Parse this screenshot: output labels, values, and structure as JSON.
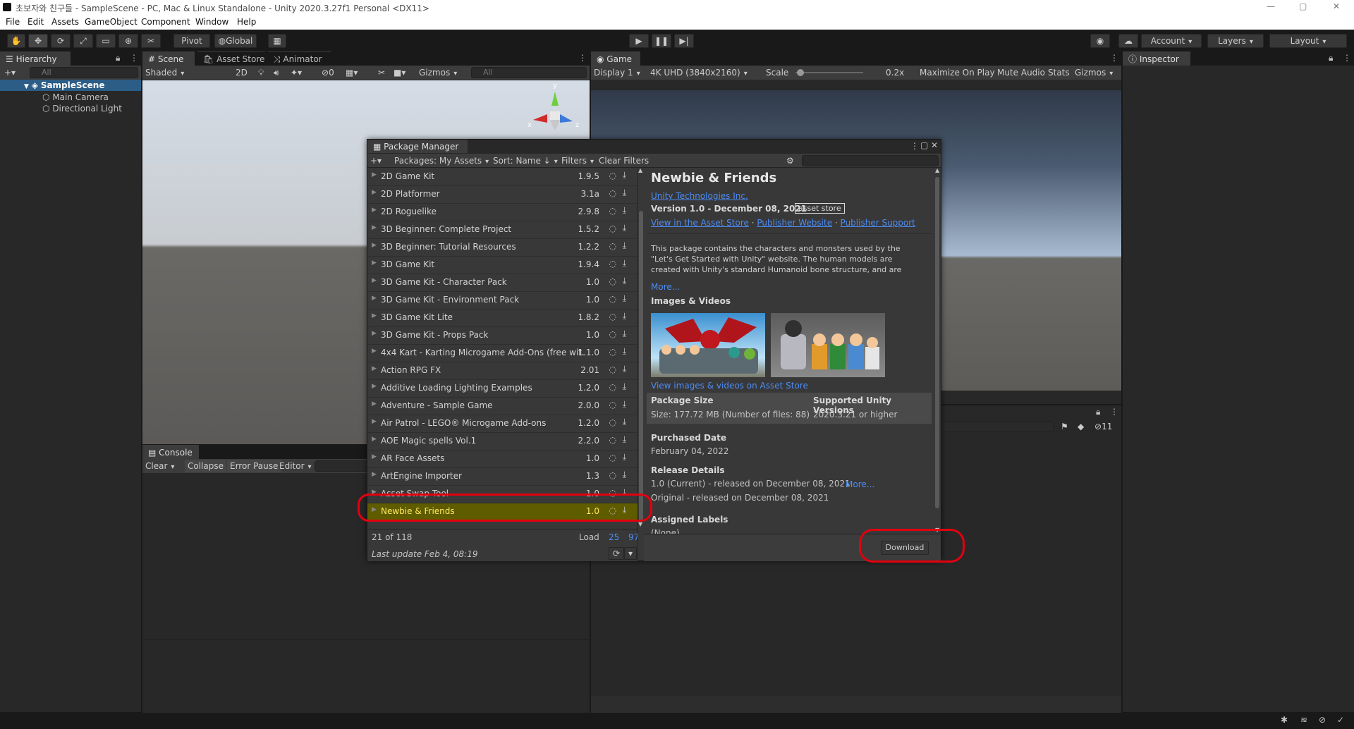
{
  "window": {
    "title": "초보자와 친구들 - SampleScene - PC, Mac & Linux Standalone - Unity 2020.3.27f1 Personal <DX11>",
    "controls": [
      "—",
      "▢",
      "✕"
    ]
  },
  "menu": [
    "File",
    "Edit",
    "Assets",
    "GameObject",
    "Component",
    "Window",
    "Help"
  ],
  "toolbar": {
    "pivot": "Pivot",
    "global": "Global",
    "account": "Account",
    "layers": "Layers",
    "layout": "Layout"
  },
  "hierarchy": {
    "tab": "Hierarchy",
    "search_placeholder": "All",
    "scene": "SampleScene",
    "items": [
      "Main Camera",
      "Directional Light"
    ]
  },
  "scene": {
    "tabs": [
      "Scene",
      "Asset Store",
      "Animator"
    ],
    "shading": "Shaded",
    "mode_2d": "2D",
    "audio_count": "0",
    "gizmos": "Gizmos",
    "search_placeholder": "All",
    "axis_x": "x",
    "axis_y": "y",
    "axis_z": "z"
  },
  "game": {
    "tab": "Game",
    "display": "Display 1",
    "resolution": "4K UHD (3840x2160)",
    "scale_label": "Scale",
    "scale_value": "0.2x",
    "scale_level": 0.02,
    "maximize": "Maximize On Play",
    "mute": "Mute Audio",
    "stats": "Stats",
    "gizmos": "Gizmos"
  },
  "inspector": {
    "tab": "Inspector"
  },
  "console": {
    "tab": "Console",
    "clear": "Clear",
    "collapse": "Collapse",
    "error_pause": "Error Pause",
    "editor": "Editor"
  },
  "project_panel": {
    "count": "11"
  },
  "package_manager": {
    "title": "Package Manager",
    "packages_filter": "Packages: My Assets",
    "sort": "Sort: Name ↓",
    "filters": "Filters",
    "clear_filters": "Clear Filters",
    "list": [
      {
        "name": "2D Game Kit",
        "version": "1.9.5"
      },
      {
        "name": "2D Platformer",
        "version": "3.1a"
      },
      {
        "name": "2D Roguelike",
        "version": "2.9.8"
      },
      {
        "name": "3D Beginner: Complete Project",
        "version": "1.5.2"
      },
      {
        "name": "3D Beginner: Tutorial Resources",
        "version": "1.2.2"
      },
      {
        "name": "3D Game Kit",
        "version": "1.9.4"
      },
      {
        "name": "3D Game Kit - Character Pack",
        "version": "1.0"
      },
      {
        "name": "3D Game Kit - Environment Pack",
        "version": "1.0"
      },
      {
        "name": "3D Game Kit Lite",
        "version": "1.8.2"
      },
      {
        "name": "3D Game Kit - Props Pack",
        "version": "1.0"
      },
      {
        "name": "4x4 Kart - Karting Microgame Add-Ons (free wit...",
        "version": "1.1.0"
      },
      {
        "name": "Action RPG FX",
        "version": "2.01"
      },
      {
        "name": "Additive Loading Lighting Examples",
        "version": "1.2.0"
      },
      {
        "name": "Adventure - Sample Game",
        "version": "2.0.0"
      },
      {
        "name": "Air Patrol - LEGO® Microgame Add-ons",
        "version": "1.2.0"
      },
      {
        "name": "AOE Magic spells Vol.1",
        "version": "2.2.0"
      },
      {
        "name": "AR Face Assets",
        "version": "1.0"
      },
      {
        "name": "ArtEngine Importer",
        "version": "1.3"
      },
      {
        "name": "Asset Swap Tool",
        "version": "1.0"
      },
      {
        "name": "Newbie & Friends",
        "version": "1.0"
      }
    ],
    "count_text": "21 of 118",
    "load_label": "Load",
    "load_25": "25",
    "load_97": "97",
    "last_update": "Last update Feb 4, 08:19",
    "detail": {
      "name": "Newbie & Friends",
      "publisher": "Unity Technologies Inc.",
      "version_line": "Version 1.0 - December 08, 2021",
      "badge": "asset store",
      "link_store": "View in the Asset Store",
      "link_website": "Publisher Website",
      "link_support": "Publisher Support",
      "desc1": "This package contains the characters and monsters used by the",
      "desc2": "\"Let's Get Started with Unity\" website. The human models are",
      "desc3": "created with Unity's standard Humanoid bone structure, and are",
      "more": "More...",
      "images_heading": "Images & Videos",
      "view_images": "View images & videos on Asset Store",
      "size_heading": "Package Size",
      "size_value": "Size: 177.72 MB (Number of files: 88)",
      "unity_heading": "Supported Unity Versions",
      "unity_value": "2020.3.21 or higher",
      "purchased_heading": "Purchased Date",
      "purchased_value": "February 04, 2022",
      "release_heading": "Release Details",
      "release_current": "1.0 (Current) - released on December 08, 2021",
      "release_more": "More...",
      "release_original": "Original - released on December 08, 2021",
      "labels_heading": "Assigned Labels",
      "labels_value": "(None)"
    },
    "download": "Download"
  },
  "colors": {
    "selection": "#5f5c00",
    "selection_text": "#ffe85a",
    "link": "#4c8cf5",
    "annotation": "#e3000f"
  }
}
